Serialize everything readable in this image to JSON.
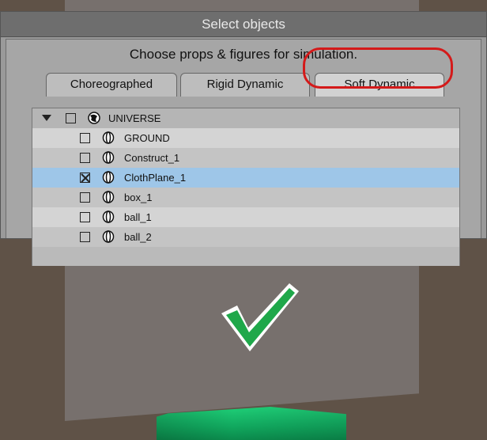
{
  "window": {
    "title": "Select objects"
  },
  "prompt": "Choose props & figures for simulation.",
  "tabs": [
    {
      "label": "Choreographed",
      "active": false
    },
    {
      "label": "Rigid Dynamic",
      "active": false
    },
    {
      "label": "Soft Dynamic",
      "active": true
    }
  ],
  "tree": {
    "root": {
      "label": "UNIVERSE",
      "checked": false,
      "icon": "globe-icon"
    },
    "items": [
      {
        "label": "GROUND",
        "checked": false,
        "icon": "prop-icon"
      },
      {
        "label": "Construct_1",
        "checked": false,
        "icon": "prop-icon"
      },
      {
        "label": "ClothPlane_1",
        "checked": true,
        "icon": "prop-icon"
      },
      {
        "label": "box_1",
        "checked": false,
        "icon": "prop-icon"
      },
      {
        "label": "ball_1",
        "checked": false,
        "icon": "prop-icon"
      },
      {
        "label": "ball_2",
        "checked": false,
        "icon": "prop-icon"
      }
    ]
  },
  "colors": {
    "highlight": "#d41a1a",
    "checkmark": "#1fa84a",
    "selected_row": "#9ec6e8"
  }
}
